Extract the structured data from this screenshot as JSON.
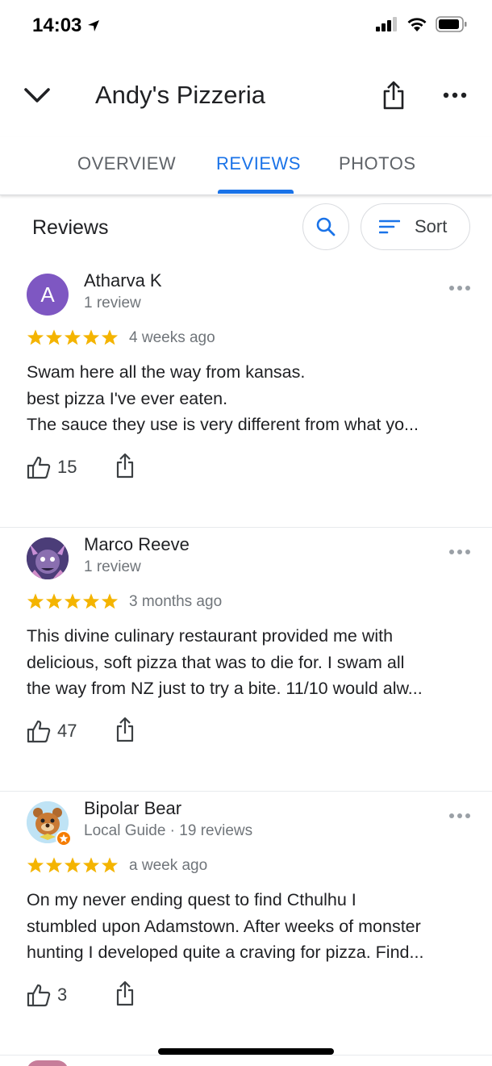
{
  "status_bar": {
    "time": "14:03",
    "icons": [
      "location-arrow-icon",
      "cellular-signal-icon",
      "wifi-icon",
      "battery-icon"
    ]
  },
  "header": {
    "title": "Andy's Pizzeria",
    "icons": [
      "chevron-down-icon",
      "share-icon",
      "more-horizontal-icon"
    ]
  },
  "tabs": [
    {
      "label": "OVERVIEW",
      "active": false
    },
    {
      "label": "REVIEWS",
      "active": true
    },
    {
      "label": "PHOTOS",
      "active": false
    }
  ],
  "reviews_section": {
    "heading": "Reviews",
    "sort_label": "Sort",
    "icons": [
      "search-icon",
      "sort-icon"
    ]
  },
  "colors": {
    "accent": "#1a73e8",
    "star": "#f4b400",
    "text_primary": "#202124",
    "text_secondary": "#70757a",
    "avatar_letter_bg": "#7e57c2"
  },
  "reviews": [
    {
      "avatar_letter": "A",
      "name": "Atharva K",
      "meta": "1 review",
      "rating": 5,
      "date": "4 weeks ago",
      "lines": [
        "Swam here all the way from kansas.",
        "best pizza I've ever eaten.",
        "The sauce they use is very different from what yo..."
      ],
      "likes": "15"
    },
    {
      "avatar_letter": "",
      "name": "Marco Reeve",
      "meta": "1 review",
      "rating": 5,
      "date": "3 months ago",
      "lines": [
        "This divine culinary restaurant provided me with",
        "delicious, soft pizza that was to die for. I swam all",
        "the way from NZ just to try a bite. 11/10 would alw..."
      ],
      "likes": "47"
    },
    {
      "avatar_letter": "",
      "name": "Bipolar Bear",
      "meta": "Local Guide · 19 reviews",
      "rating": 5,
      "date": "a week ago",
      "lines": [
        "On my never ending quest to find Cthulhu I",
        "stumbled upon Adamstown. After weeks of monster",
        "hunting I developed quite a craving for pizza. Find..."
      ],
      "likes": "3"
    }
  ]
}
